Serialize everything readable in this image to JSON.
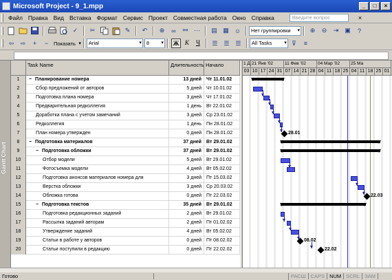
{
  "window": {
    "title": "Microsoft Project - 9_1.mpp",
    "controls": [
      "_",
      "□",
      "×"
    ]
  },
  "menu": {
    "items": [
      "Файл",
      "Правка",
      "Вид",
      "Вставка",
      "Формат",
      "Сервис",
      "Проект",
      "Совместная работа",
      "Окно",
      "Справка"
    ],
    "help_placeholder": "Введите вопрос",
    "close_symbol": "×"
  },
  "toolbar": {
    "grouping": "Нет группировки",
    "show_label": "Показать",
    "font": "Arial",
    "font_size": "8",
    "bold": "Ж",
    "italic": "К",
    "underline": "Ч",
    "filter": "All Tasks"
  },
  "view": {
    "label": "Gantt Chart"
  },
  "table": {
    "headers": {
      "id": "",
      "name": "Task Name",
      "duration": "Длительность",
      "start": "Начало"
    },
    "rows": [
      {
        "id": "1",
        "name": "Планирование номера",
        "duration": "13 дней",
        "start": "Чт 11.01.02",
        "level": 0,
        "summary": true
      },
      {
        "id": "2",
        "name": "Сбор предложений от авторов",
        "duration": "5 дней",
        "start": "Чт 10.01.02",
        "level": 1,
        "summary": false
      },
      {
        "id": "3",
        "name": "Подготовка плана номера",
        "duration": "3 дней",
        "start": "Чт 17.01.02",
        "level": 1,
        "summary": false
      },
      {
        "id": "4",
        "name": "Предварительная редколлегия",
        "duration": "1 день",
        "start": "Вт 22.01.02",
        "level": 1,
        "summary": false
      },
      {
        "id": "5",
        "name": "Доработка плана с учетом замечаний",
        "duration": "3 дней",
        "start": "Ср 23.01.02",
        "level": 1,
        "summary": false
      },
      {
        "id": "6",
        "name": "Редколлегия",
        "duration": "1 день",
        "start": "Пн 28.01.02",
        "level": 1,
        "summary": false
      },
      {
        "id": "7",
        "name": "План номера утвержден",
        "duration": "0 дней",
        "start": "Пн 28.01.02",
        "level": 1,
        "summary": false
      },
      {
        "id": "8",
        "name": "Подготовка материалов",
        "duration": "37 дней",
        "start": "Вт 29.01.02",
        "level": 0,
        "summary": true
      },
      {
        "id": "9",
        "name": "Подготовка обложки",
        "duration": "37 дней",
        "start": "Вт 29.01.02",
        "level": 1,
        "summary": true
      },
      {
        "id": "10",
        "name": "Отбор модели",
        "duration": "5 дней",
        "start": "Вт 29.01.02",
        "level": 2,
        "summary": false
      },
      {
        "id": "11",
        "name": "Фотосъемка модели",
        "duration": "4 дней",
        "start": "Вт 05.02.02",
        "level": 2,
        "summary": false
      },
      {
        "id": "12",
        "name": "Подготовка анонсов материалов номера для",
        "duration": "3 дней",
        "start": "Пт 15.03.02",
        "level": 2,
        "summary": false
      },
      {
        "id": "13",
        "name": "Верстка обложки",
        "duration": "3 дней",
        "start": "Ср 20.03.02",
        "level": 2,
        "summary": false
      },
      {
        "id": "14",
        "name": "Обложка готова",
        "duration": "0 дней",
        "start": "Пт 22.03.02",
        "level": 2,
        "summary": false
      },
      {
        "id": "15",
        "name": "Подготовка текстов",
        "duration": "35 дней",
        "start": "Вт 29.01.02",
        "level": 1,
        "summary": true
      },
      {
        "id": "16",
        "name": "Подготовка редакционных заданий",
        "duration": "2 дней",
        "start": "Вт 29.01.02",
        "level": 2,
        "summary": false
      },
      {
        "id": "17",
        "name": "Рассылка заданий авторам",
        "duration": "2 дней",
        "start": "Пт 01.02.02",
        "level": 2,
        "summary": false
      },
      {
        "id": "18",
        "name": "Утверждение заданий",
        "duration": "4 дней",
        "start": "Вт 05.02.02",
        "level": 2,
        "summary": false
      },
      {
        "id": "19",
        "name": "Статьи в работе у авторов",
        "duration": "0 дней",
        "start": "Пт 08.02.02",
        "level": 2,
        "summary": false
      },
      {
        "id": "20",
        "name": "Статьи поступили в редакцию",
        "duration": "0 дней",
        "start": "Пт 22.02.02",
        "level": 2,
        "summary": false
      }
    ]
  },
  "timescale": {
    "major": [
      "1 Дек '01",
      "21 Янв '02",
      "11 Фев '02",
      "04 Мар '02",
      "25 Ма"
    ],
    "minor": [
      "03",
      "10",
      "17",
      "24",
      "31",
      "07",
      "14",
      "21",
      "28",
      "04",
      "11",
      "18",
      "25",
      "04",
      "11",
      "18",
      "25",
      "01"
    ],
    "minor_partial_note": "",
    "milestones": [
      {
        "row": 7,
        "label": "28.01"
      },
      {
        "row": 14,
        "label": "22.03"
      },
      {
        "row": 19,
        "label": "08.02"
      },
      {
        "row": 20,
        "label": "22.02"
      }
    ]
  },
  "status": {
    "ready": "Готово",
    "indicators": [
      {
        "label": "РАСШ",
        "active": false
      },
      {
        "label": "CAPS",
        "active": false
      },
      {
        "label": "NUM",
        "active": true
      },
      {
        "label": "SCRL",
        "active": false
      },
      {
        "label": "ЗАМ",
        "active": false
      }
    ]
  },
  "colors": {
    "title_bar": "#1b47b5",
    "task_bar": "#4a50e0",
    "summary_bar": "#000000",
    "link": "#1c22a0"
  }
}
